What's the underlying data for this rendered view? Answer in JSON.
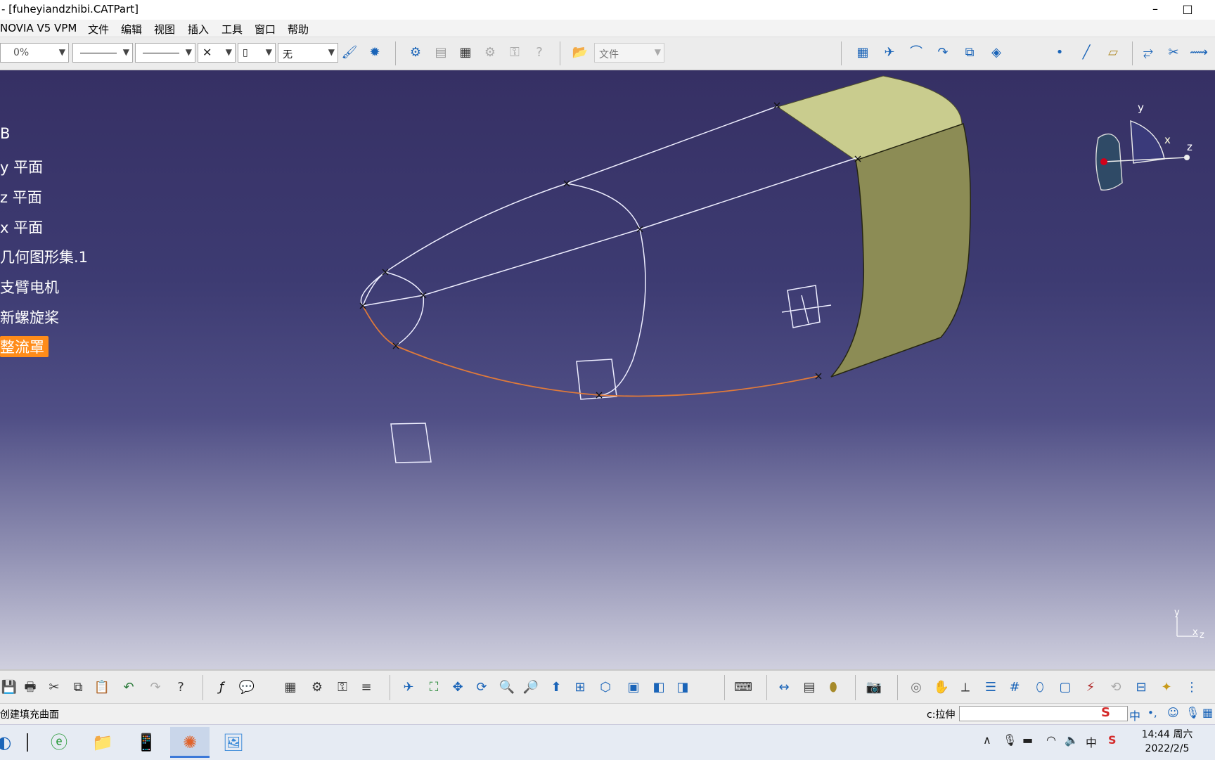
{
  "window": {
    "title": "- [fuheyiandzhibi.CATPart]",
    "minimize": "–",
    "maximize": "□"
  },
  "menu": [
    "NOVIA V5 VPM",
    "文件",
    "编辑",
    "视图",
    "插入",
    "工具",
    "窗口",
    "帮助"
  ],
  "toolbar_top": {
    "transparency": "0%",
    "layer": "无",
    "file_filter": "文件"
  },
  "tree": {
    "items": [
      {
        "label": "B"
      },
      {
        "label": "y 平面"
      },
      {
        "label": "z 平面"
      },
      {
        "label": "x 平面"
      },
      {
        "label": "几何图形集.1"
      },
      {
        "label": "支臂电机"
      },
      {
        "label": "新螺旋桨"
      },
      {
        "label": "整流罩",
        "selected": true
      }
    ]
  },
  "compass": {
    "y": "y",
    "x": "x",
    "z": "z"
  },
  "axis_triad": {
    "y": "y",
    "x": "x",
    "z": "z"
  },
  "status": {
    "message": "创建填充曲面",
    "command_label": "c:拉伸",
    "command_value": ""
  },
  "ime": {
    "mode": "中"
  },
  "clock": {
    "time": "14:44 周六",
    "date": "2022/2/5"
  },
  "colors": {
    "viewport_top": "#363064",
    "viewport_bottom": "#cfcfde",
    "surface": "#9a9a5e",
    "surface_light": "#c9cc8e",
    "selected_curve": "#e07a3a",
    "wire": "#ffffff",
    "selection_highlight": "#ff8c1a"
  }
}
